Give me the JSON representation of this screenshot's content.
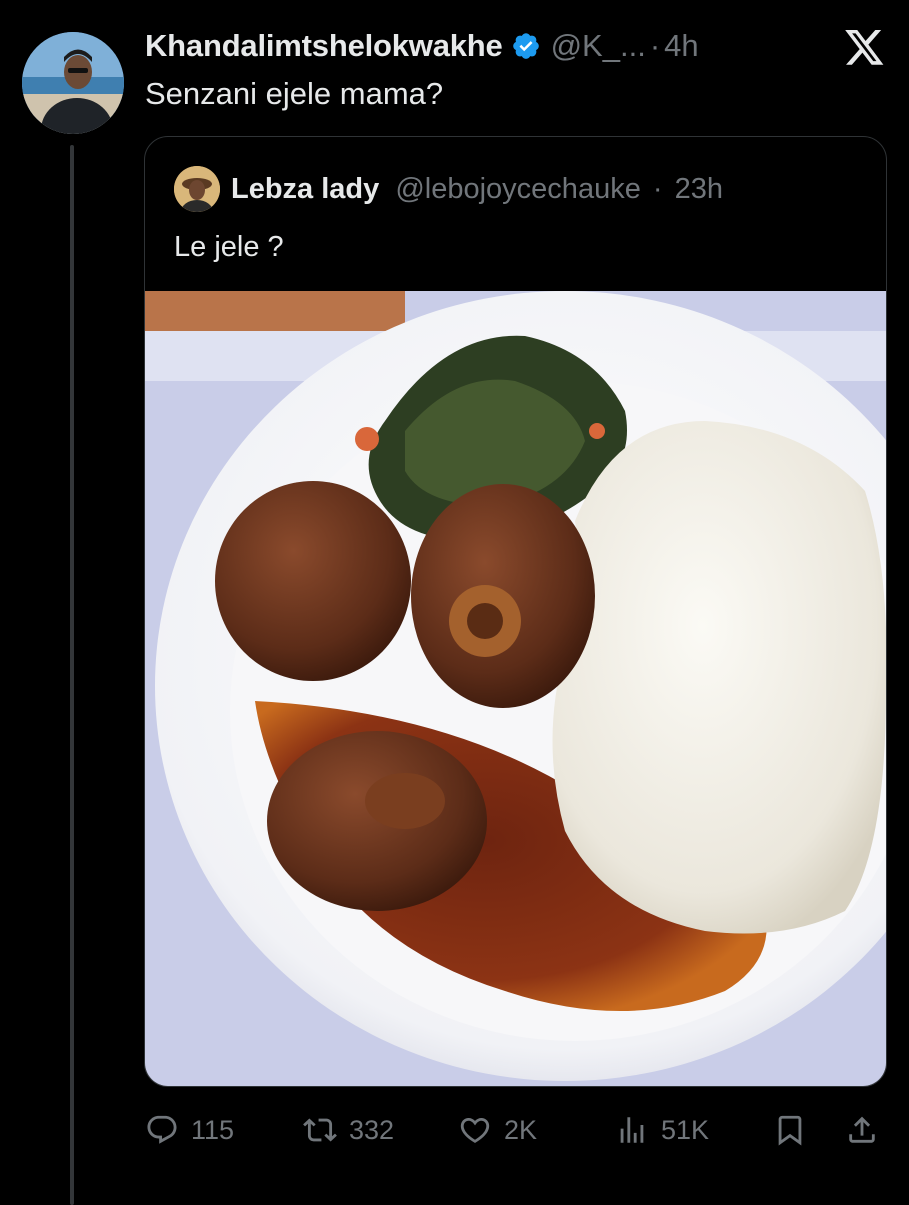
{
  "tweet": {
    "display_name": "Khandalimtshelokwakhe",
    "verified_icon": "verified-badge-icon",
    "handle": "@K_...",
    "separator": "·",
    "time": "4h",
    "text": "Senzani ejele mama?"
  },
  "quote": {
    "display_name": "Lebza lady",
    "handle": "@lebojoycechauke",
    "separator": "·",
    "time": "23h",
    "text": "Le jele ?"
  },
  "actions": {
    "replies": "115",
    "reposts": "332",
    "likes": "2K",
    "views": "51K"
  },
  "colors": {
    "background": "#000000",
    "text_primary": "#e7e9ea",
    "text_muted": "#71767b",
    "verified_blue": "#1d9bf0",
    "border": "#2f3336"
  }
}
